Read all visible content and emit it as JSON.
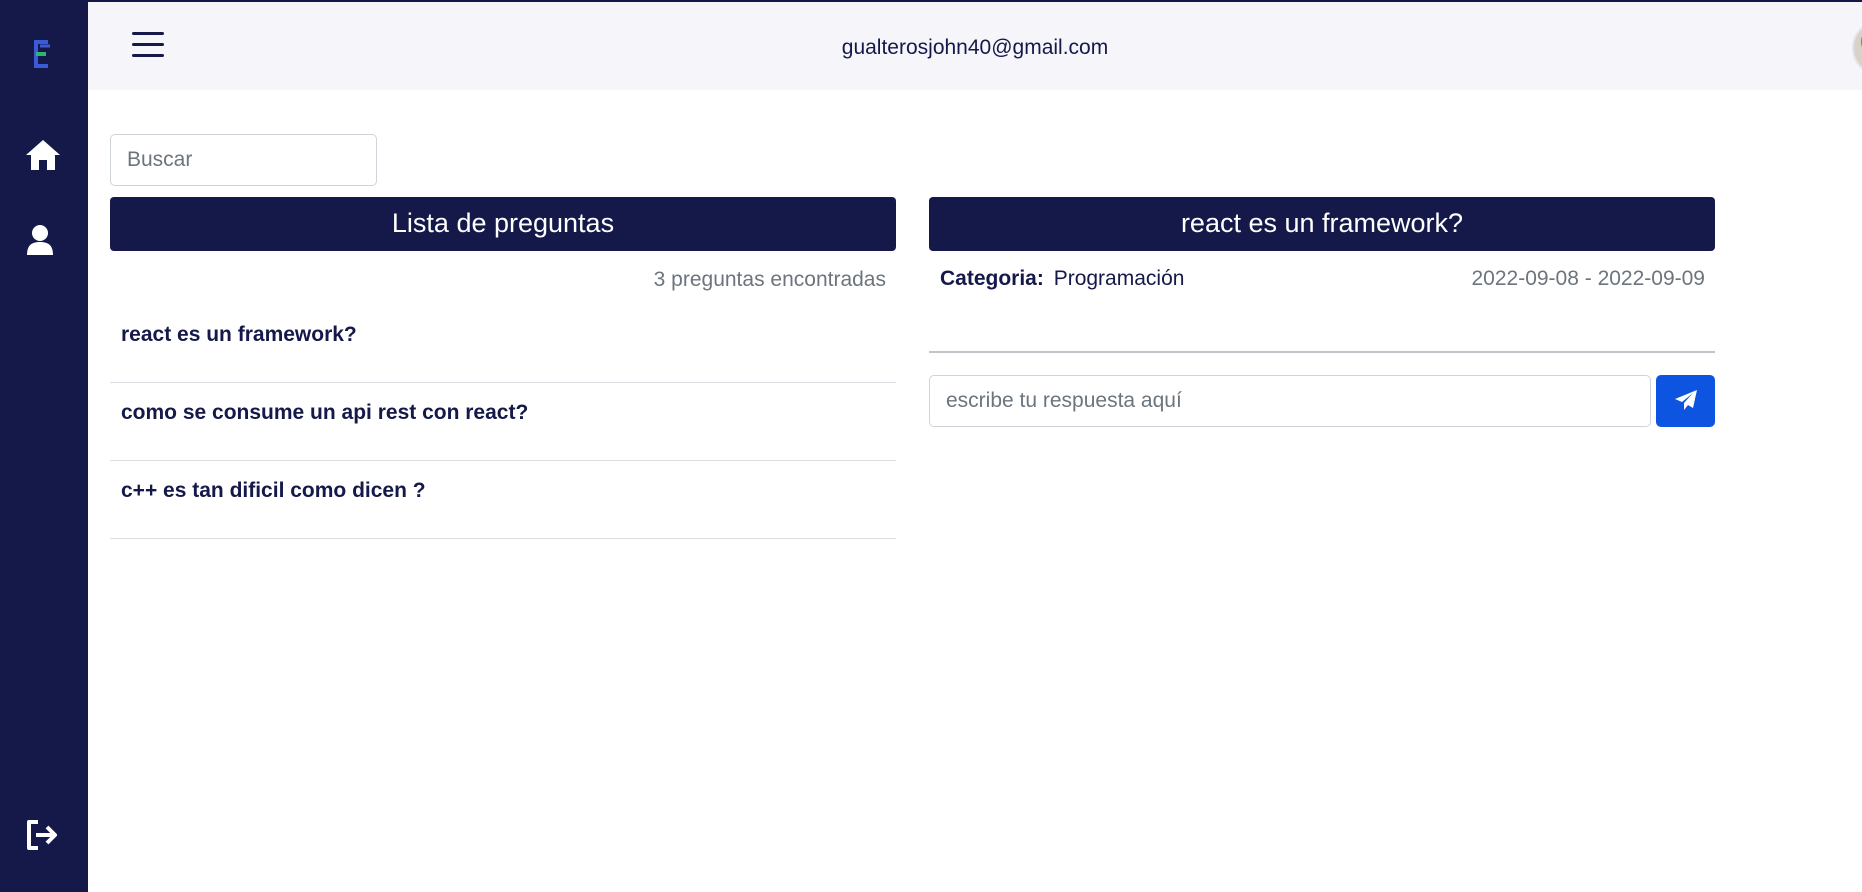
{
  "topbar": {
    "user_email": "gualterosjohn40@gmail.com"
  },
  "search": {
    "placeholder": "Buscar"
  },
  "question_list": {
    "title": "Lista de preguntas",
    "count_text": "3 preguntas encontradas",
    "items": [
      {
        "label": "react es un framework?"
      },
      {
        "label": "como se consume un api rest con react?"
      },
      {
        "label": "c++ es tan dificil como dicen ?"
      }
    ]
  },
  "question_detail": {
    "title": "react es un framework?",
    "category_label": "Categoria:",
    "category_value": "Programación",
    "dates": "2022-09-08 - 2022-09-09",
    "answer_placeholder": "escribe tu respuesta aquí"
  },
  "icons": {
    "logo": "app-logo-icon",
    "home": "home-icon",
    "user": "user-icon",
    "logout": "logout-icon",
    "menu": "hamburger-menu-icon",
    "send": "paper-plane-icon"
  },
  "colors": {
    "navy": "#14194a",
    "accent_blue": "#0d55e0",
    "topbar_bg": "#f6f6fa"
  }
}
